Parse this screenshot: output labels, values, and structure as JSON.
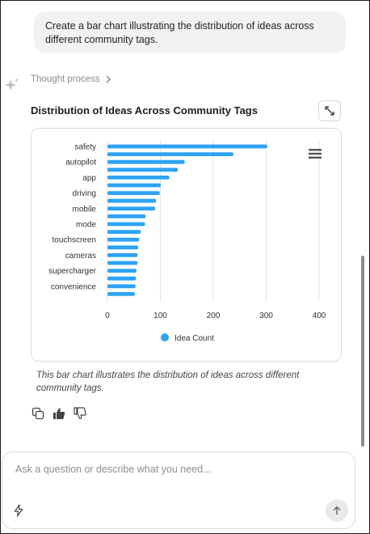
{
  "conversation": {
    "user_message": "Create a bar chart illustrating the distribution of ideas across different community tags.",
    "thought_process_label": "Thought process",
    "caption": "This bar chart illustrates the distribution of ideas across different community tags."
  },
  "chart_data": {
    "type": "bar",
    "orientation": "horizontal",
    "title": "Distribution of Ideas Across Community Tags",
    "categories": [
      "safety",
      "",
      "autopilot",
      "",
      "app",
      "",
      "driving",
      "",
      "mobile",
      "",
      "mode",
      "",
      "touchscreen",
      "",
      "cameras",
      "",
      "supercharger",
      "",
      "convenience",
      ""
    ],
    "series": [
      {
        "name": "Idea Count",
        "color": "#2ea3f2",
        "values": [
          302,
          238,
          146,
          133,
          117,
          101,
          99,
          92,
          90,
          72,
          71,
          63,
          60,
          58,
          57,
          57,
          55,
          54,
          53,
          52
        ]
      }
    ],
    "xlim": [
      0,
      400
    ],
    "xticks": [
      "0",
      "100",
      "200",
      "300",
      "400"
    ],
    "grid": true,
    "legend_position": "bottom"
  },
  "icons": {
    "spark": "sparkle-icon",
    "expand": "expand-icon",
    "menu": "hamburger-menu-icon",
    "copy": "copy-icon",
    "like": "thumbs-up-icon",
    "dislike": "thumbs-down-icon",
    "bolt": "lightning-icon",
    "send": "arrow-up-icon"
  },
  "composer": {
    "placeholder": "Ask a question or describe what you need..."
  }
}
